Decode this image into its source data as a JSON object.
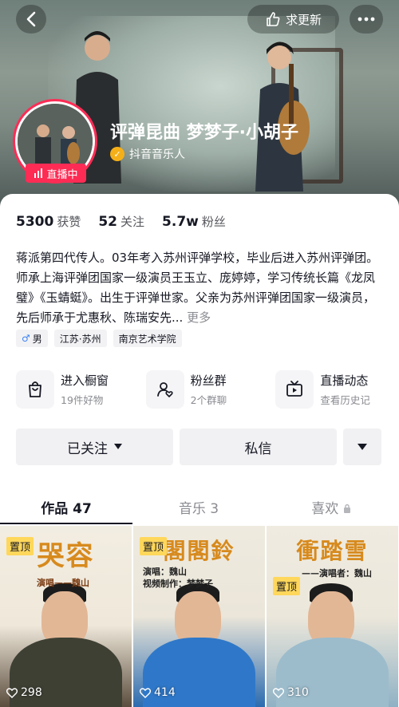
{
  "header": {
    "update_label": "求更新",
    "nickname": "评弹昆曲 梦梦子·小胡子",
    "verified_label": "抖音音乐人",
    "live_label": "直播中",
    "accent": "#fe2c55"
  },
  "stats": [
    {
      "value": "5300",
      "label": "获赞"
    },
    {
      "value": "52",
      "label": "关注"
    },
    {
      "value": "5.7w",
      "label": "粉丝"
    }
  ],
  "bio": {
    "text": "蒋派第四代传人。03年考入苏州评弹学校，毕业后进入苏州评弹团。师承上海评弹团国家一级演员王玉立、庞婷婷，学习传统长篇《龙凤璧》《玉蜻蜓》。出生于评弹世家。父亲为苏州评弹团国家一级演员，先后师承于尤惠秋、陈瑞安先...",
    "more": "更多"
  },
  "tags": [
    {
      "label": "男",
      "icon": "male-icon"
    },
    {
      "label": "江苏·苏州"
    },
    {
      "label": "南京艺术学院"
    }
  ],
  "shortcuts": [
    {
      "title": "进入橱窗",
      "sub": "19件好物",
      "icon": "shopping-bag-icon"
    },
    {
      "title": "粉丝群",
      "sub": "2个群聊",
      "icon": "fan-group-icon"
    },
    {
      "title": "直播动态",
      "sub": "查看历史记",
      "icon": "tv-icon"
    }
  ],
  "actions": {
    "follow": "已关注",
    "message": "私信"
  },
  "tabs": [
    {
      "label": "作品 47",
      "active": true
    },
    {
      "label": "音乐 3",
      "active": false
    },
    {
      "label": "喜欢",
      "active": false,
      "icon": "lock-icon"
    }
  ],
  "videos": [
    {
      "pin": "置顶",
      "title": "哭容",
      "credit": "演唱——魏山",
      "likes": "298"
    },
    {
      "pin": "置顶",
      "title": "閣閣鈴",
      "credit": "演唱：魏山\n视频制作：梦梦子",
      "likes": "414"
    },
    {
      "pin": "置顶",
      "title": "衝踏雪",
      "credit": "——演唱者：魏山",
      "likes": "310"
    }
  ]
}
